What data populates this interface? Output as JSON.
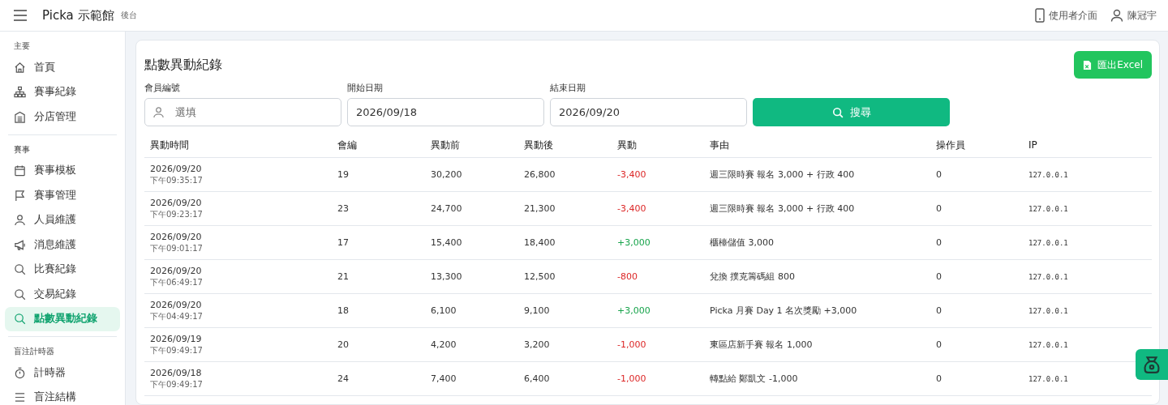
{
  "header": {
    "brand": "Picka 示範館",
    "subtitle": "後台",
    "links": [
      {
        "kind": "phone",
        "label": "使用者介面"
      },
      {
        "kind": "user",
        "label": "陳冠宇"
      }
    ]
  },
  "sidebar": {
    "sections": [
      {
        "title": "主要",
        "items": [
          {
            "kind": "home",
            "label": "首頁",
            "selected": false
          },
          {
            "kind": "sitemap",
            "label": "賽事紀錄",
            "selected": false
          },
          {
            "kind": "building",
            "label": "分店管理",
            "selected": false
          }
        ]
      },
      {
        "title": "賽事",
        "items": [
          {
            "kind": "calendar",
            "label": "賽事模板",
            "selected": false
          },
          {
            "kind": "flag",
            "label": "賽事管理",
            "selected": false
          },
          {
            "kind": "user",
            "label": "人員維護",
            "selected": false
          },
          {
            "kind": "megaphone",
            "label": "消息維護",
            "selected": false
          },
          {
            "kind": "search",
            "label": "比賽紀錄",
            "selected": false
          },
          {
            "kind": "search",
            "label": "交易紀錄",
            "selected": false
          },
          {
            "kind": "search",
            "label": "點數異動紀錄",
            "selected": true
          }
        ]
      },
      {
        "title": "盲注計時器",
        "items": [
          {
            "kind": "timer",
            "label": "計時器",
            "selected": false
          },
          {
            "kind": "list",
            "label": "盲注結構",
            "selected": false
          }
        ]
      }
    ]
  },
  "page": {
    "title": "點數異動紀錄",
    "export_button": "匯出Excel",
    "filters": [
      {
        "label": "會員編號",
        "placeholder": "選填"
      },
      {
        "label": "開始日期",
        "value": "2026/09/18"
      },
      {
        "label": "結束日期",
        "value": "2026/09/20"
      }
    ],
    "search_button": "搜尋"
  },
  "table": {
    "columns": [
      "異動時間",
      "會編",
      "異動前",
      "異動後",
      "異動",
      "事由",
      "操作員",
      "IP"
    ],
    "rows": [
      {
        "date": "2026/09/20",
        "time": "下午09:35:17",
        "member": "19",
        "before": "30,200",
        "after": "26,800",
        "change": "-3,400",
        "kind": "debit",
        "reason": "週三限時賽 報名 3,000 + 行政 400",
        "operator": "0",
        "ip": "127.0.0.1"
      },
      {
        "date": "2026/09/20",
        "time": "下午09:23:17",
        "member": "23",
        "before": "24,700",
        "after": "21,300",
        "change": "-3,400",
        "kind": "debit",
        "reason": "週三限時賽 報名 3,000 + 行政 400",
        "operator": "0",
        "ip": "127.0.0.1"
      },
      {
        "date": "2026/09/20",
        "time": "下午09:01:17",
        "member": "17",
        "before": "15,400",
        "after": "18,400",
        "change": "+3,000",
        "kind": "credit",
        "reason": "櫃檯儲值 3,000",
        "operator": "0",
        "ip": "127.0.0.1"
      },
      {
        "date": "2026/09/20",
        "time": "下午06:49:17",
        "member": "21",
        "before": "13,300",
        "after": "12,500",
        "change": "-800",
        "kind": "debit",
        "reason": "兌換 撲克籌碼組 800",
        "operator": "0",
        "ip": "127.0.0.1"
      },
      {
        "date": "2026/09/20",
        "time": "下午04:49:17",
        "member": "18",
        "before": "6,100",
        "after": "9,100",
        "change": "+3,000",
        "kind": "credit",
        "reason": "Picka 月賽 Day 1 名次獎勵 +3,000",
        "operator": "0",
        "ip": "127.0.0.1"
      },
      {
        "date": "2026/09/19",
        "time": "下午09:49:17",
        "member": "20",
        "before": "4,200",
        "after": "3,200",
        "change": "-1,000",
        "kind": "debit",
        "reason": "東區店新手賽 報名 1,000",
        "operator": "0",
        "ip": "127.0.0.1"
      },
      {
        "date": "2026/09/18",
        "time": "下午09:49:17",
        "member": "24",
        "before": "7,400",
        "after": "6,400",
        "change": "-1,000",
        "kind": "debit",
        "reason": "轉點給 鄭凱文 -1,000",
        "operator": "0",
        "ip": "127.0.0.1"
      }
    ]
  }
}
